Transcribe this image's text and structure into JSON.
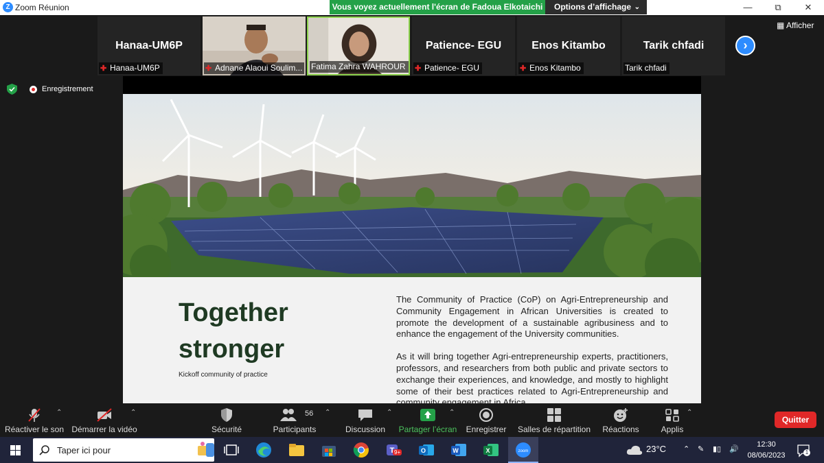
{
  "window": {
    "title": "Zoom Réunion",
    "share_banner": "Vous voyez actuellement l'écran de Fadoua Elkotaichi",
    "view_options": "Options d’affichage"
  },
  "participants": [
    {
      "display": "Hanaa-UM6P",
      "label": "Hanaa-UM6P",
      "muted": true,
      "video": false
    },
    {
      "display": "",
      "label": "Adnane Alaoui Soulim...",
      "muted": true,
      "video": true
    },
    {
      "display": "",
      "label": "Fatima Zahra WAHROUR",
      "muted": false,
      "video": true,
      "active_speaker": true
    },
    {
      "display": "Patience- EGU",
      "label": "Patience- EGU",
      "muted": true,
      "video": false
    },
    {
      "display": "Enos Kitambo",
      "label": "Enos Kitambo",
      "muted": true,
      "video": false
    },
    {
      "display": "Tarik chfadi",
      "label": "Tarik chfadi",
      "muted": false,
      "video": false
    }
  ],
  "strip": {
    "show_label": "Afficher",
    "next_icon": "chevron-right-icon"
  },
  "status": {
    "recording_label": "Enregistrement"
  },
  "slide": {
    "headline_line1": "Together",
    "headline_line2": "stronger",
    "subtitle": "Kickoff community of practice",
    "paragraph1": "The Community of Practice (CoP) on Agri-Entrepreneurship and Community Engagement in African Universities is created to promote the development of a sustainable agribusiness and to enhance the engagement of the University communities.",
    "paragraph2": "As it will bring together Agri-entrepreneurship experts, practitioners, professors, and researchers from both public and private sectors to exchange their experiences, and knowledge, and mostly to highlight some of their best practices related to Agri-Entrepreneurship and community engagement in Africa."
  },
  "toolbar": {
    "unmute": "Réactiver le son",
    "start_video": "Démarrer la vidéo",
    "security": "Sécurité",
    "participants": "Participants",
    "participants_count": "56",
    "chat": "Discussion",
    "share": "Partager l’écran",
    "record": "Enregistrer",
    "breakout": "Salles de répartition",
    "reactions": "Réactions",
    "apps": "Applis",
    "quit": "Quitter"
  },
  "taskbar": {
    "search_placeholder": "Taper ici pour",
    "temperature": "23°C",
    "time": "12:30",
    "date": "08/06/2023",
    "notification_count": "1",
    "teams_badge": "9+"
  },
  "colors": {
    "zoom_blue": "#2d8cff",
    "share_green": "#24a148",
    "quit_red": "#e02828",
    "headline_green": "#1f3a23",
    "taskbar": "#20243a"
  }
}
